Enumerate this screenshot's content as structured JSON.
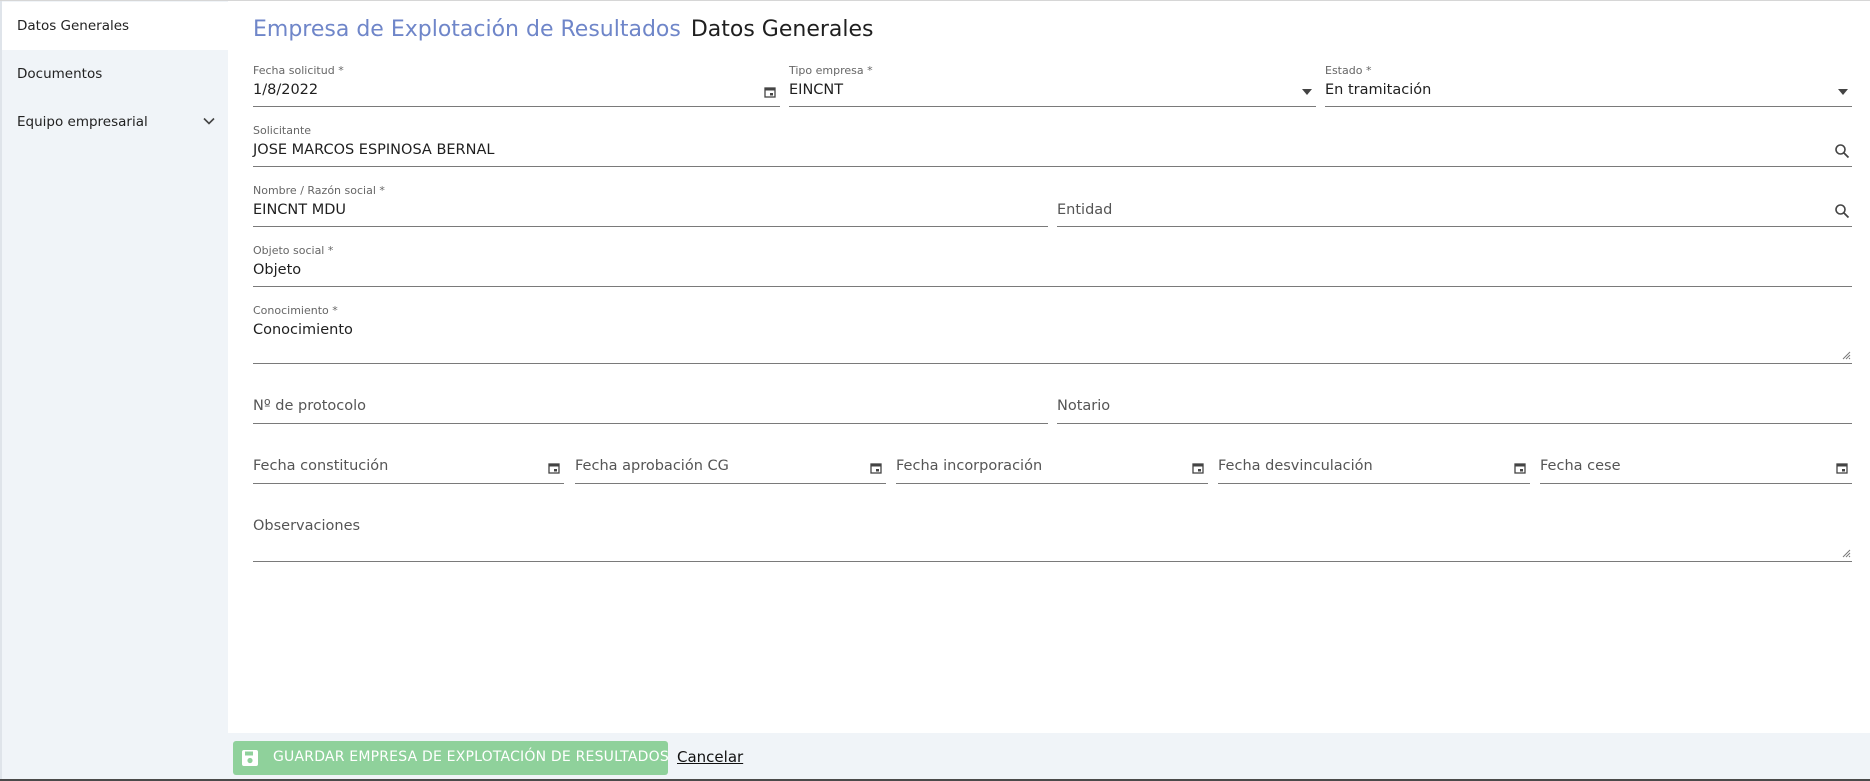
{
  "sidebar": {
    "items": [
      {
        "label": "Datos Generales"
      },
      {
        "label": "Documentos"
      },
      {
        "label": "Equipo empresarial"
      }
    ]
  },
  "header": {
    "section": "Empresa de Explotación de Resultados",
    "page": "Datos Generales"
  },
  "form": {
    "fecha_solicitud": {
      "label": "Fecha solicitud *",
      "value": "1/8/2022"
    },
    "tipo_empresa": {
      "label": "Tipo empresa *",
      "value": "EINCNT"
    },
    "estado": {
      "label": "Estado *",
      "value": "En tramitación"
    },
    "solicitante": {
      "label": "Solicitante",
      "value": "JOSE MARCOS ESPINOSA BERNAL"
    },
    "nombre": {
      "label": "Nombre / Razón social *",
      "value": "EINCNT MDU"
    },
    "entidad": {
      "placeholder": "Entidad"
    },
    "objeto_social": {
      "label": "Objeto social *",
      "value": "Objeto"
    },
    "conocimiento": {
      "label": "Conocimiento *",
      "value": "Conocimiento"
    },
    "protocolo": {
      "placeholder": "Nº de protocolo"
    },
    "notario": {
      "placeholder": "Notario"
    },
    "fecha_constitucion": {
      "placeholder": "Fecha constitución"
    },
    "fecha_aprobacion": {
      "placeholder": "Fecha aprobación CG"
    },
    "fecha_incorporacion": {
      "placeholder": "Fecha incorporación"
    },
    "fecha_desvinculacion": {
      "placeholder": "Fecha desvinculación"
    },
    "fecha_cese": {
      "placeholder": "Fecha cese"
    },
    "observaciones": {
      "placeholder": "Observaciones"
    }
  },
  "footer": {
    "save_label": "GUARDAR EMPRESA DE EXPLOTACIÓN DE RESULTADOS",
    "cancel_label": "Cancelar"
  },
  "colors": {
    "accent": "#6f86c9",
    "save_button": "#8fd19b",
    "sidebar_bg": "#f0f4f8"
  },
  "icons": [
    "calendar-icon",
    "dropdown-arrow-icon",
    "search-icon",
    "chevron-down-icon",
    "save-icon",
    "resize-handle-icon"
  ]
}
